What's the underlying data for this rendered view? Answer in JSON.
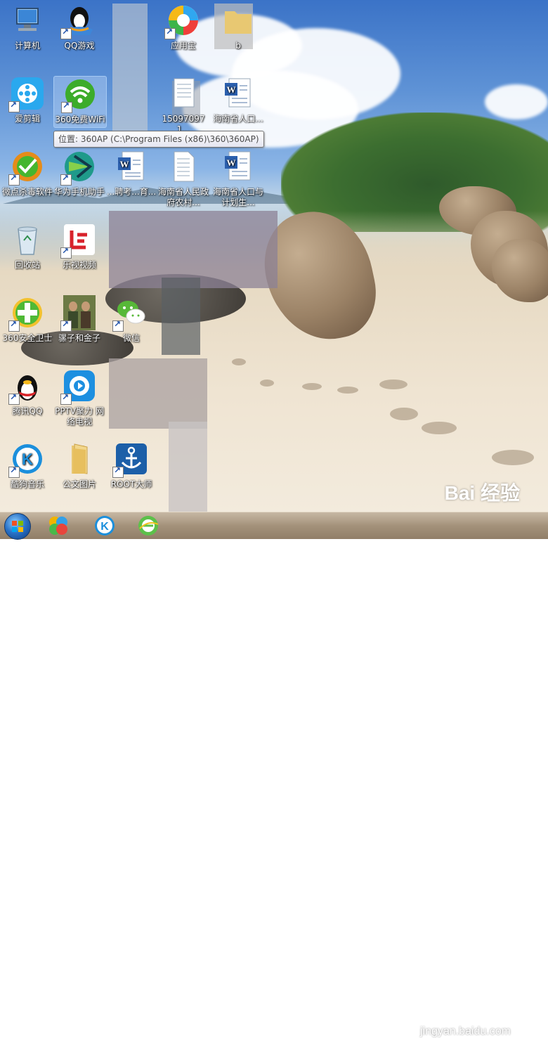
{
  "desktop": {
    "icons": [
      {
        "label": "计算机"
      },
      {
        "label": "QQ游戏"
      },
      {
        "label": "应用宝"
      },
      {
        "label": "b"
      },
      {
        "label": "爱剪辑"
      },
      {
        "label": "360免费WiFi"
      },
      {
        "label": "150970971..."
      },
      {
        "label": "海南省人口..."
      },
      {
        "label": "微点杀毒软件"
      },
      {
        "label": "华为手机助手"
      },
      {
        "label": "...聘考...育..."
      },
      {
        "label": "海南省人民政府农村..."
      },
      {
        "label": "海南省人口与计划生..."
      },
      {
        "label": "回收站"
      },
      {
        "label": "乐视视频"
      },
      {
        "label": "360安全卫士"
      },
      {
        "label": "骡子和金子"
      },
      {
        "label": "微信"
      },
      {
        "label": "腾讯QQ"
      },
      {
        "label": "PPTV聚力 网络电视"
      },
      {
        "label": "酷狗音乐"
      },
      {
        "label": "公文图片"
      },
      {
        "label": "ROOT大师"
      }
    ],
    "tooltip": "位置: 360AP (C:\\Program Files (x86)\\360\\360AP)"
  },
  "watermark": {
    "brand": "Bai 经验",
    "url": "jingyan.baidu.com"
  },
  "colors": {
    "taskbar": "#a4927b",
    "tooltip_border": "#767676"
  }
}
